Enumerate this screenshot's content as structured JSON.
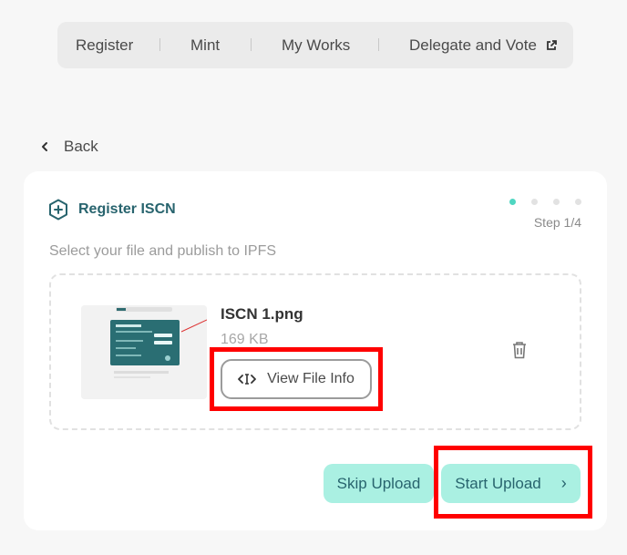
{
  "nav": {
    "items": [
      {
        "label": "Register"
      },
      {
        "label": "Mint"
      },
      {
        "label": "My Works"
      },
      {
        "label": "Delegate and Vote"
      }
    ],
    "external_icon": "external-link-icon"
  },
  "back": {
    "label": "Back",
    "icon": "chevron-left-icon"
  },
  "card": {
    "title": "Register ISCN",
    "title_icon": "hex-plus-icon",
    "step_label": "Step 1/4",
    "steps_total": 4,
    "step_current": 1,
    "subtitle": "Select your file and publish to IPFS",
    "file": {
      "name": "ISCN 1.png",
      "size": "169 KB",
      "view_label": "View File Info",
      "view_icon": "code-icon",
      "delete_icon": "trash-icon"
    },
    "buttons": {
      "skip": "Skip Upload",
      "start": "Start Upload",
      "start_icon": "chevron-right-icon"
    }
  },
  "colors": {
    "accent": "#4fd6c1",
    "button_bg": "#aaf0e2",
    "title": "#28646e",
    "highlight": "#ff0000"
  }
}
